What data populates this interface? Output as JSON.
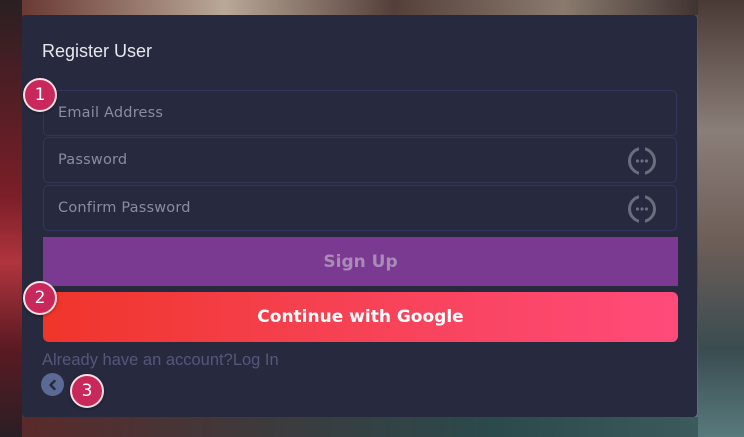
{
  "form": {
    "title": "Register User",
    "email_placeholder": "Email Address",
    "password_placeholder": "Password",
    "confirm_password_placeholder": "Confirm Password",
    "password_toggle_icon": "eye-off-icon",
    "signup_label": "Sign Up",
    "google_label": "Continue with Google",
    "login_prompt": "Already have an account?",
    "login_link": "Log In",
    "back_icon": "chevron-left-icon"
  },
  "markers": [
    "1",
    "2",
    "3"
  ],
  "colors": {
    "card_bg": "#272a3e",
    "signup_bg": "#7a3a92",
    "google_gradient_start": "#f0352a",
    "google_gradient_end": "#ff4b7a",
    "marker_bg": "#c8285a",
    "back_button_bg": "#5a6a94"
  }
}
